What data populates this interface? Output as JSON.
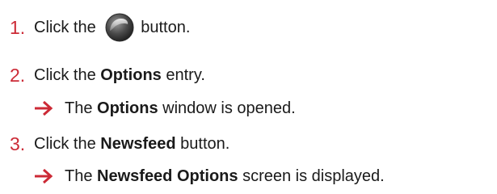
{
  "steps": [
    {
      "number": "1.",
      "before": "Click the ",
      "icon": "app-orb-button-icon",
      "after": "button."
    },
    {
      "number": "2.",
      "before": "Click the ",
      "bold": "Options",
      "after": " entry.",
      "result": {
        "before": "The ",
        "bold": "Options",
        "after": " window is opened."
      }
    },
    {
      "number": "3.",
      "before": "Click the ",
      "bold": "Newsfeed",
      "after": " button.",
      "result": {
        "before": "The ",
        "bold": "Newsfeed Options",
        "after": " screen is displayed."
      }
    }
  ],
  "colors": {
    "accent": "#cc2a36",
    "text": "#1a1a1a"
  }
}
